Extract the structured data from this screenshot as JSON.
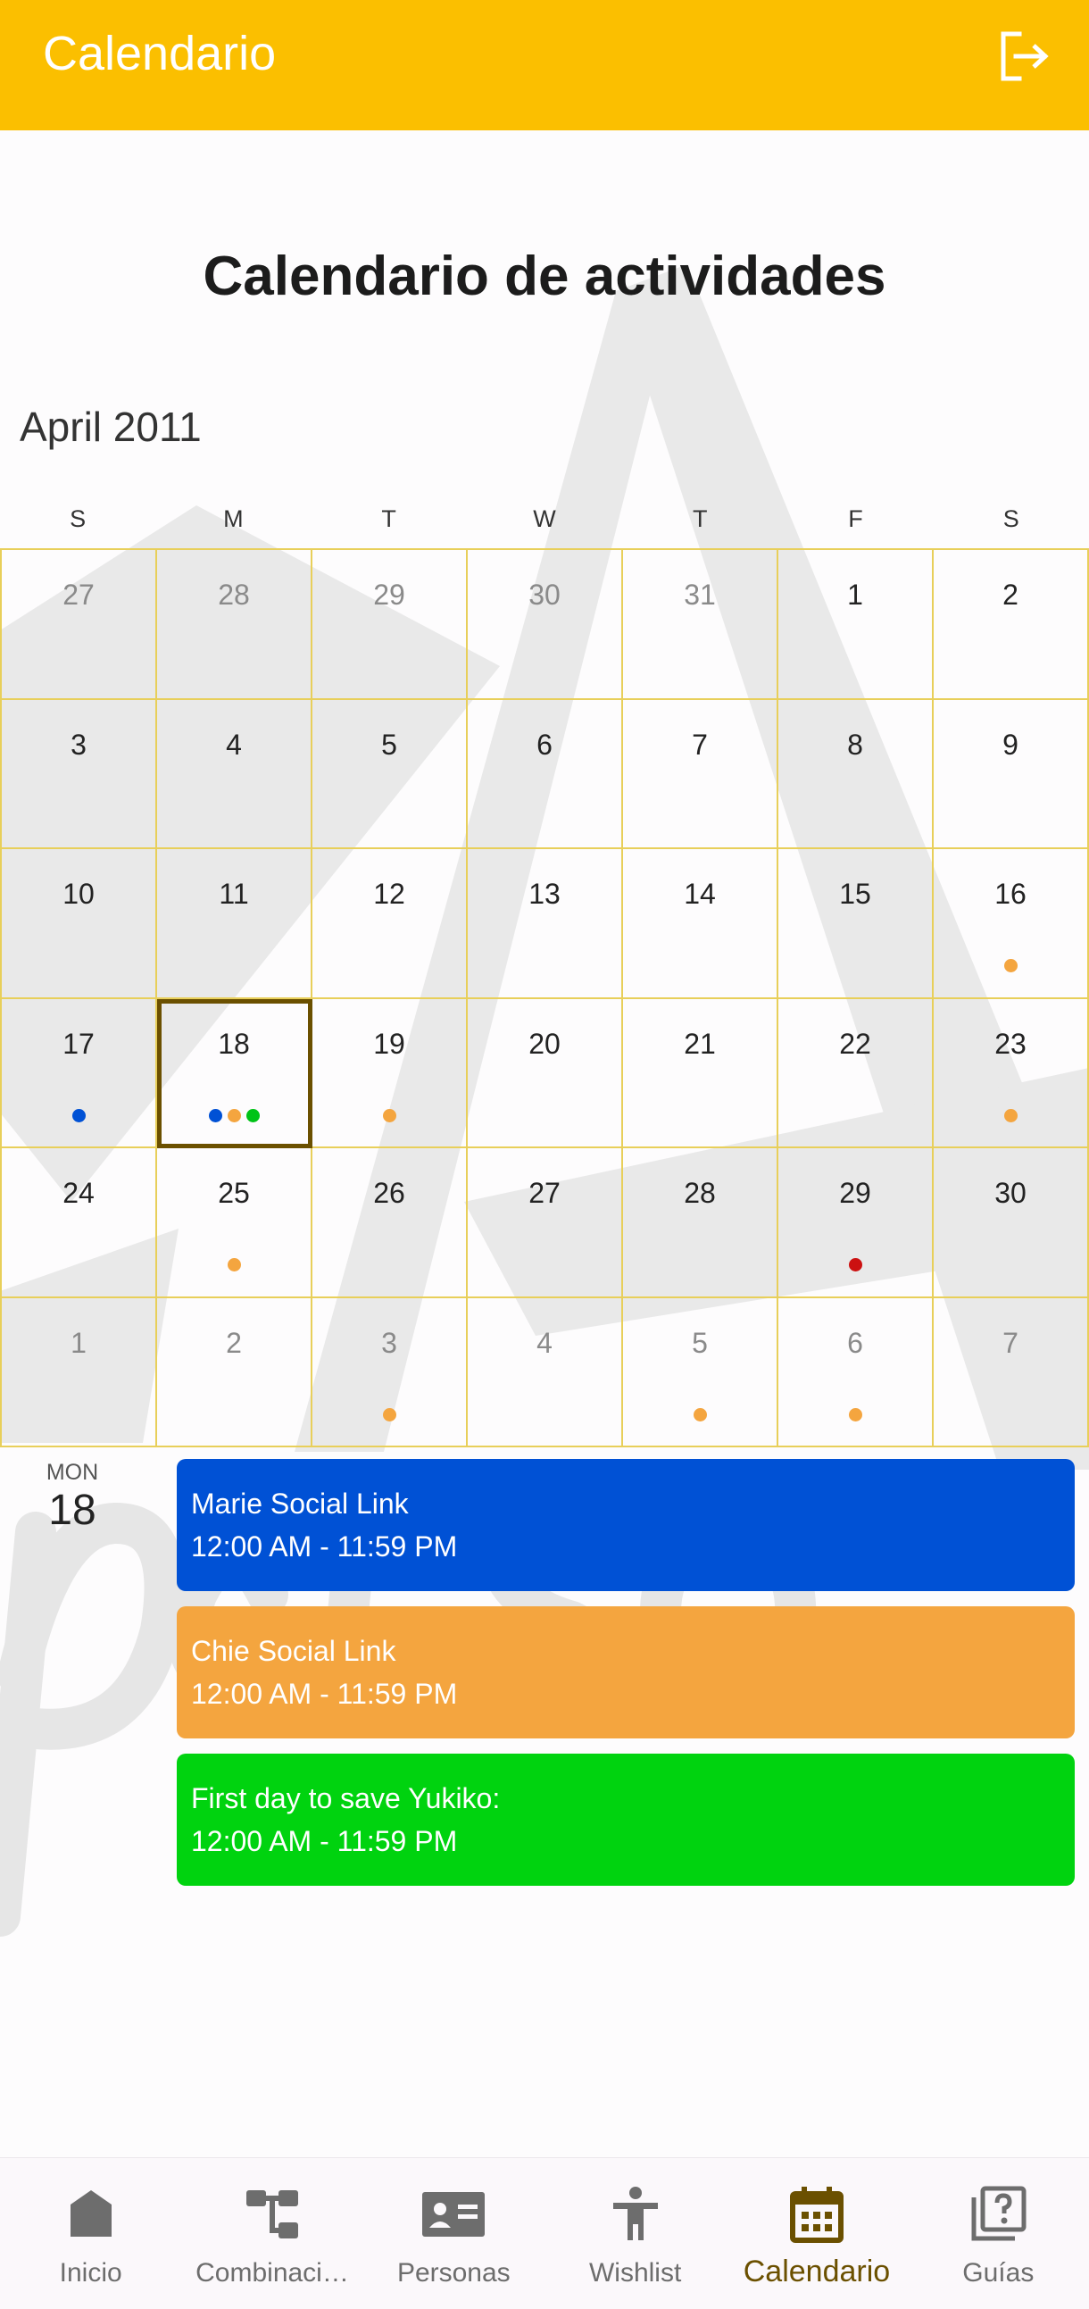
{
  "appbar": {
    "title": "Calendario"
  },
  "page": {
    "title": "Calendario de actividades"
  },
  "calendar": {
    "month_label": "April 2011",
    "weekdays": [
      "S",
      "M",
      "T",
      "W",
      "T",
      "F",
      "S"
    ],
    "weeks": [
      [
        {
          "day": "27",
          "muted": true,
          "dots": []
        },
        {
          "day": "28",
          "muted": true,
          "dots": []
        },
        {
          "day": "29",
          "muted": true,
          "dots": []
        },
        {
          "day": "30",
          "muted": true,
          "dots": []
        },
        {
          "day": "31",
          "muted": true,
          "dots": []
        },
        {
          "day": "1",
          "muted": false,
          "dots": []
        },
        {
          "day": "2",
          "muted": false,
          "dots": []
        }
      ],
      [
        {
          "day": "3",
          "muted": false,
          "dots": []
        },
        {
          "day": "4",
          "muted": false,
          "dots": []
        },
        {
          "day": "5",
          "muted": false,
          "dots": []
        },
        {
          "day": "6",
          "muted": false,
          "dots": []
        },
        {
          "day": "7",
          "muted": false,
          "dots": []
        },
        {
          "day": "8",
          "muted": false,
          "dots": []
        },
        {
          "day": "9",
          "muted": false,
          "dots": []
        }
      ],
      [
        {
          "day": "10",
          "muted": false,
          "dots": []
        },
        {
          "day": "11",
          "muted": false,
          "dots": []
        },
        {
          "day": "12",
          "muted": false,
          "dots": []
        },
        {
          "day": "13",
          "muted": false,
          "dots": []
        },
        {
          "day": "14",
          "muted": false,
          "dots": []
        },
        {
          "day": "15",
          "muted": false,
          "dots": []
        },
        {
          "day": "16",
          "muted": false,
          "dots": [
            "#f4a53f"
          ]
        }
      ],
      [
        {
          "day": "17",
          "muted": false,
          "dots": [
            "#0051d5"
          ]
        },
        {
          "day": "18",
          "muted": false,
          "selected": true,
          "dots": [
            "#0051d5",
            "#f4a53f",
            "#00c317"
          ]
        },
        {
          "day": "19",
          "muted": false,
          "dots": [
            "#f4a53f"
          ]
        },
        {
          "day": "20",
          "muted": false,
          "dots": []
        },
        {
          "day": "21",
          "muted": false,
          "dots": []
        },
        {
          "day": "22",
          "muted": false,
          "dots": []
        },
        {
          "day": "23",
          "muted": false,
          "dots": [
            "#f4a53f"
          ]
        }
      ],
      [
        {
          "day": "24",
          "muted": false,
          "dots": []
        },
        {
          "day": "25",
          "muted": false,
          "dots": [
            "#f4a53f"
          ]
        },
        {
          "day": "26",
          "muted": false,
          "dots": []
        },
        {
          "day": "27",
          "muted": false,
          "dots": []
        },
        {
          "day": "28",
          "muted": false,
          "dots": []
        },
        {
          "day": "29",
          "muted": false,
          "dots": [
            "#cc1111"
          ]
        },
        {
          "day": "30",
          "muted": false,
          "dots": []
        }
      ],
      [
        {
          "day": "1",
          "muted": true,
          "dots": []
        },
        {
          "day": "2",
          "muted": true,
          "dots": []
        },
        {
          "day": "3",
          "muted": true,
          "dots": [
            "#f4a53f"
          ]
        },
        {
          "day": "4",
          "muted": true,
          "dots": []
        },
        {
          "day": "5",
          "muted": true,
          "dots": [
            "#f4a53f"
          ]
        },
        {
          "day": "6",
          "muted": true,
          "dots": [
            "#f4a53f"
          ]
        },
        {
          "day": "7",
          "muted": true,
          "dots": []
        }
      ]
    ]
  },
  "schedule": {
    "day_abbr": "MON",
    "day_num": "18",
    "events": [
      {
        "title": "Marie Social Link",
        "time": "12:00 AM - 11:59 PM",
        "color": "#0051d5"
      },
      {
        "title": "Chie Social Link",
        "time": "12:00 AM - 11:59 PM",
        "color": "#f4a53f"
      },
      {
        "title": "First day to save Yukiko:",
        "time": "12:00 AM - 11:59 PM",
        "color": "#00d30f"
      }
    ]
  },
  "nav": {
    "items": [
      {
        "label": "Inicio",
        "icon": "home-icon",
        "active": false
      },
      {
        "label": "Combinaci…",
        "icon": "fusion-tree-icon",
        "active": false
      },
      {
        "label": "Personas",
        "icon": "contact-card-icon",
        "active": false
      },
      {
        "label": "Wishlist",
        "icon": "person-icon",
        "active": false
      },
      {
        "label": "Calendario",
        "icon": "calendar-icon",
        "active": true
      },
      {
        "label": "Guías",
        "icon": "help-book-icon",
        "active": false
      }
    ]
  },
  "colors": {
    "accent": "#fbbf00",
    "selected_border": "#6b5000",
    "grid_line": "#e8cf5a"
  }
}
